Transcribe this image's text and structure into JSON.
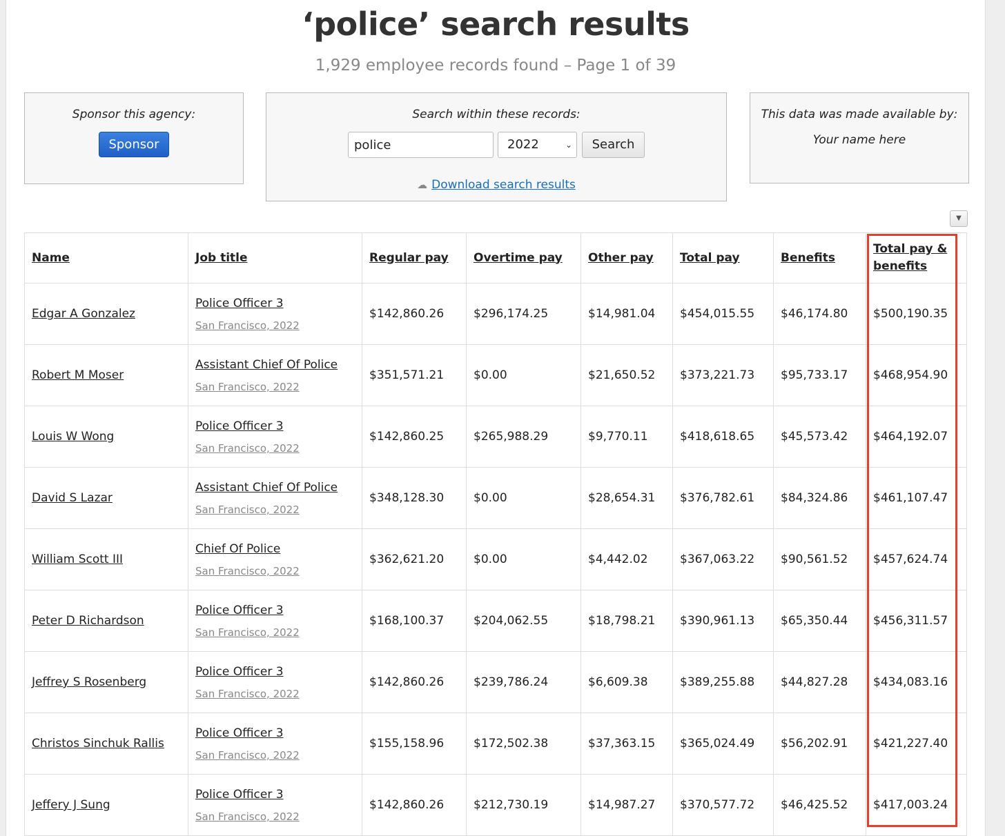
{
  "header": {
    "title": "‘police’ search results",
    "subtitle": "1,929 employee records found – Page 1 of 39"
  },
  "sponsor": {
    "label": "Sponsor this agency:",
    "button": "Sponsor"
  },
  "search": {
    "label": "Search within these records:",
    "query": "police",
    "year": "2022",
    "button": "Search",
    "download": "Download search results"
  },
  "credit": {
    "label": "This data was made available by:",
    "name": "Your name here"
  },
  "table": {
    "columns": [
      "Name",
      "Job title",
      "Regular pay",
      "Overtime pay",
      "Other pay",
      "Total pay",
      "Benefits",
      "Total pay & benefits"
    ],
    "rows": [
      {
        "name": "Edgar A Gonzalez",
        "job": "Police Officer 3",
        "loc": "San Francisco, 2022",
        "regular": "$142,860.26",
        "overtime": "$296,174.25",
        "other": "$14,981.04",
        "total": "$454,015.55",
        "benefits": "$46,174.80",
        "total_benefits": "$500,190.35"
      },
      {
        "name": "Robert M Moser",
        "job": "Assistant Chief Of Police",
        "loc": "San Francisco, 2022",
        "regular": "$351,571.21",
        "overtime": "$0.00",
        "other": "$21,650.52",
        "total": "$373,221.73",
        "benefits": "$95,733.17",
        "total_benefits": "$468,954.90"
      },
      {
        "name": "Louis W Wong",
        "job": "Police Officer 3",
        "loc": "San Francisco, 2022",
        "regular": "$142,860.25",
        "overtime": "$265,988.29",
        "other": "$9,770.11",
        "total": "$418,618.65",
        "benefits": "$45,573.42",
        "total_benefits": "$464,192.07"
      },
      {
        "name": "David S Lazar",
        "job": "Assistant Chief Of Police",
        "loc": "San Francisco, 2022",
        "regular": "$348,128.30",
        "overtime": "$0.00",
        "other": "$28,654.31",
        "total": "$376,782.61",
        "benefits": "$84,324.86",
        "total_benefits": "$461,107.47"
      },
      {
        "name": "William Scott III",
        "job": "Chief Of Police",
        "loc": "San Francisco, 2022",
        "regular": "$362,621.20",
        "overtime": "$0.00",
        "other": "$4,442.02",
        "total": "$367,063.22",
        "benefits": "$90,561.52",
        "total_benefits": "$457,624.74"
      },
      {
        "name": "Peter D Richardson",
        "job": "Police Officer 3",
        "loc": "San Francisco, 2022",
        "regular": "$168,100.37",
        "overtime": "$204,062.55",
        "other": "$18,798.21",
        "total": "$390,961.13",
        "benefits": "$65,350.44",
        "total_benefits": "$456,311.57"
      },
      {
        "name": "Jeffrey S Rosenberg",
        "job": "Police Officer 3",
        "loc": "San Francisco, 2022",
        "regular": "$142,860.26",
        "overtime": "$239,786.24",
        "other": "$6,609.38",
        "total": "$389,255.88",
        "benefits": "$44,827.28",
        "total_benefits": "$434,083.16"
      },
      {
        "name": "Christos Sinchuk Rallis",
        "job": "Police Officer 3",
        "loc": "San Francisco, 2022",
        "regular": "$155,158.96",
        "overtime": "$172,502.38",
        "other": "$37,363.15",
        "total": "$365,024.49",
        "benefits": "$56,202.91",
        "total_benefits": "$421,227.40"
      },
      {
        "name": "Jeffery J Sung",
        "job": "Police Officer 3",
        "loc": "San Francisco, 2022",
        "regular": "$142,860.26",
        "overtime": "$212,730.19",
        "other": "$14,987.27",
        "total": "$370,577.72",
        "benefits": "$46,425.52",
        "total_benefits": "$417,003.24"
      }
    ]
  },
  "colors": {
    "highlight": "#e0412e",
    "sponsor_button": "#1f5fc7",
    "link": "#1a6fb7"
  },
  "icons": {
    "download": "cloud-download-icon",
    "collapse": "caret-down-icon",
    "select": "chevron-down-icon"
  }
}
